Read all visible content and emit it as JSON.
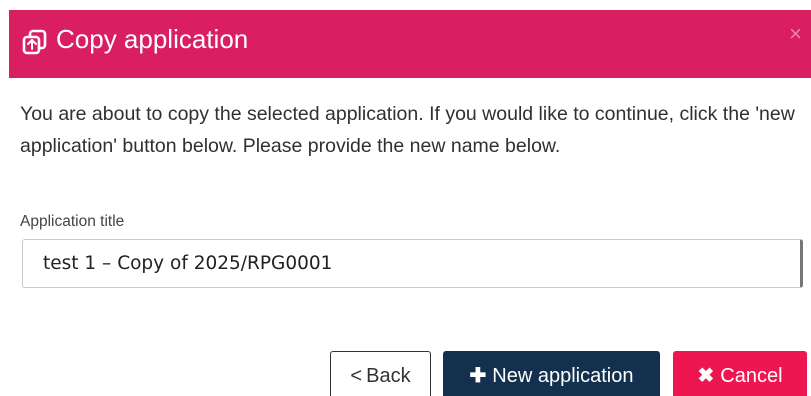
{
  "dialog": {
    "title": "Copy application",
    "close_symbol": "×",
    "header_color": "#d91f62",
    "icon": "copy-icon"
  },
  "message": "You are about to copy the selected application. If you would like to continue, click the 'new application' button below. Please provide the new name below.",
  "form": {
    "field_label": "Application title",
    "field_value": "test 1 – Copy of 2025/RPG0001"
  },
  "buttons": {
    "back_symbol": "<",
    "back_label": "Back",
    "new_symbol": "✚",
    "new_label": "New application",
    "new_color": "#14304f",
    "cancel_symbol": "✖",
    "cancel_label": "Cancel",
    "cancel_color": "#ee1650"
  }
}
